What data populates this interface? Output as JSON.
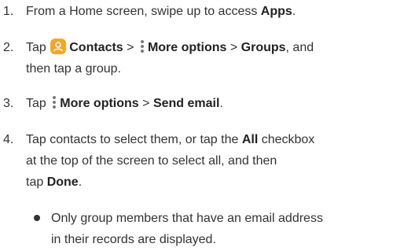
{
  "steps": [
    {
      "number": "1.",
      "before": "From a Home screen, swipe up to access ",
      "apps": "Apps",
      "after": "."
    },
    {
      "number": "2.",
      "tap": "Tap",
      "contacts": "Contacts",
      "more_options": "More options",
      "groups": "Groups",
      "after": ", and",
      "line2": "then tap a group."
    },
    {
      "number": "3.",
      "tap": "Tap",
      "more_options": "More options",
      "send_email": "Send email",
      "after": "."
    },
    {
      "number": "4.",
      "line1_before": "Tap contacts to select them, or tap the ",
      "all": "All",
      "line1_after": " checkbox",
      "line2": "at the top of the screen to select all, and then",
      "line3_before": "tap ",
      "done": "Done",
      "line3_after": "."
    }
  ],
  "bullet": {
    "line1": "Only group members that have an email address",
    "line2": "in their records are displayed."
  },
  "separator": ">",
  "icons": {
    "contacts_icon": "contacts-app-icon",
    "contacts_color": "#f6a623",
    "more_icon": "more-options-vertical-dots-icon"
  }
}
